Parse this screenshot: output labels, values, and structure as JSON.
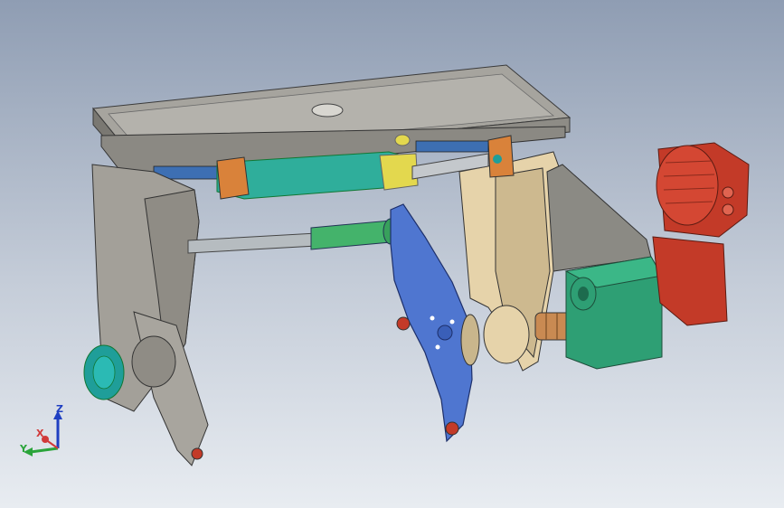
{
  "triad": {
    "z_label": "Z",
    "y_label": "Y",
    "x_label": "X"
  },
  "colors": {
    "background_top": "#8f9db3",
    "background_bottom": "#e8ecf1",
    "frame_grey": "#a3a099",
    "frame_tan": "#e6d3aa",
    "plate_blue": "#4f76d0",
    "cylinder_green": "#44b36b",
    "gearbox_green": "#2e9f74",
    "motor_red": "#c33a28",
    "bracket_orange": "#d9823a",
    "cylinder_teal": "#2fae9b",
    "accent_yellow": "#e3d84e",
    "bearing_teal": "#1f9e99"
  }
}
